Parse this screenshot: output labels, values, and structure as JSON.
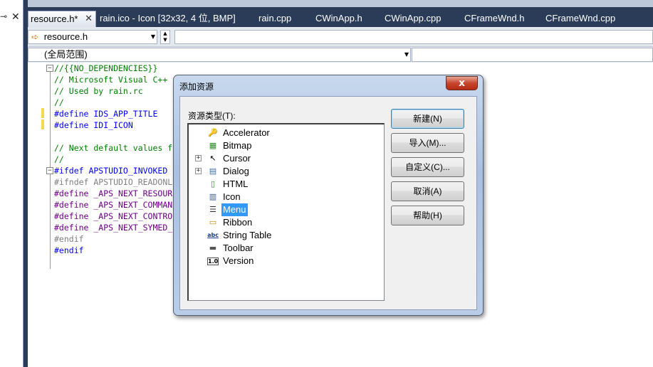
{
  "tabs": [
    {
      "label": "resource.h*",
      "active": true
    },
    {
      "label": "rain.ico - Icon [32x32, 4 位, BMP]"
    },
    {
      "label": "rain.cpp"
    },
    {
      "label": "CWinApp.h"
    },
    {
      "label": "CWinApp.cpp"
    },
    {
      "label": "CFrameWnd.h"
    },
    {
      "label": "CFrameWnd.cpp"
    }
  ],
  "tab_close": "✕",
  "left_strip": {
    "pin": "⊸",
    "close": "✕"
  },
  "nav": {
    "file_combo": "resource.h",
    "scope_combo": "(全局范围)"
  },
  "editor": {
    "lines": [
      "//{{NO_DEPENDENCIES}}",
      "// Microsoft Visual C++",
      "// Used by rain.rc",
      "//",
      "#define IDS_APP_TITLE",
      "#define IDI_ICON",
      "",
      "// Next default values f",
      "//",
      "#ifdef APSTUDIO_INVOKED",
      "#ifndef APSTUDIO_READONL",
      "#define _APS_NEXT_RESOUR",
      "#define _APS_NEXT_COMMAN",
      "#define _APS_NEXT_CONTRO",
      "#define _APS_NEXT_SYMED_",
      "#endif",
      "#endif"
    ]
  },
  "dialog": {
    "title": "添加资源",
    "close_glyph": "x",
    "type_label": "资源类型(T):",
    "resource_types": [
      {
        "label": "Accelerator",
        "icon": "accelerator-icon",
        "glyph": "🔑"
      },
      {
        "label": "Bitmap",
        "icon": "bitmap-icon",
        "glyph": "▦"
      },
      {
        "label": "Cursor",
        "icon": "cursor-icon",
        "glyph": "↖",
        "expandable": true
      },
      {
        "label": "Dialog",
        "icon": "dialog-icon",
        "glyph": "▤",
        "expandable": true
      },
      {
        "label": "HTML",
        "icon": "html-icon",
        "glyph": "▯"
      },
      {
        "label": "Icon",
        "icon": "icon-resource-icon",
        "glyph": "▥"
      },
      {
        "label": "Menu",
        "icon": "menu-icon",
        "glyph": "☰",
        "selected": true
      },
      {
        "label": "Ribbon",
        "icon": "ribbon-icon",
        "glyph": "▭"
      },
      {
        "label": "String Table",
        "icon": "string-table-icon",
        "glyph": "abc"
      },
      {
        "label": "Toolbar",
        "icon": "toolbar-icon",
        "glyph": "▬"
      },
      {
        "label": "Version",
        "icon": "version-icon",
        "glyph": "1.0"
      }
    ],
    "buttons": {
      "new": "新建(N)",
      "import": "导入(M)...",
      "custom": "自定义(C)...",
      "cancel": "取消(A)",
      "help": "帮助(H)"
    }
  }
}
